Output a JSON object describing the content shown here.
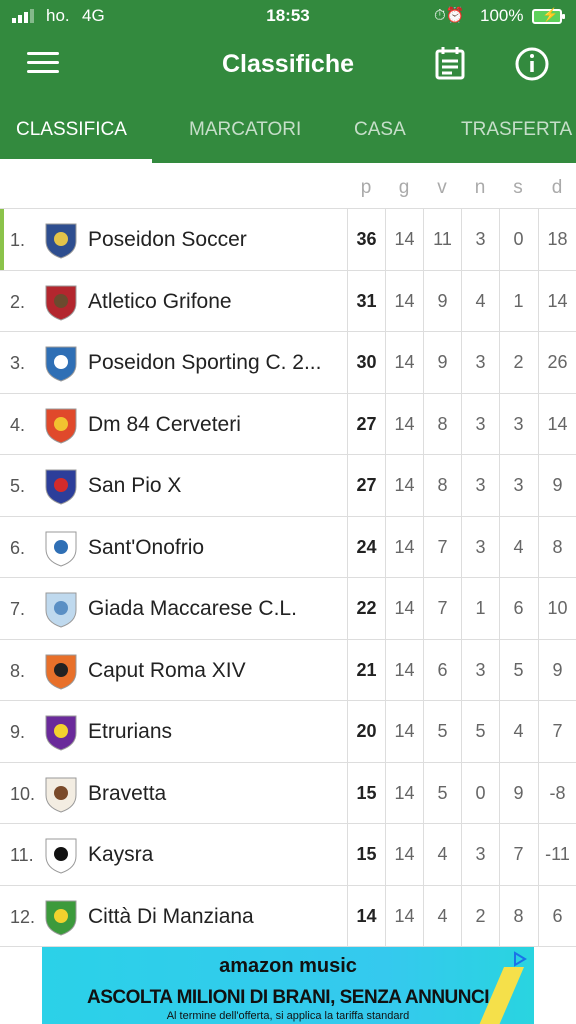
{
  "status": {
    "carrier": "ho.",
    "network": "4G",
    "time": "18:53",
    "battery": "100%"
  },
  "header": {
    "title": "Classifiche",
    "menu_icon": "hamburger-icon",
    "calendar_icon": "calendar-icon",
    "info_icon": "info-icon"
  },
  "tabs": [
    "CLASSIFICA",
    "MARCATORI",
    "CASA",
    "TRASFERTA"
  ],
  "columns": [
    "p",
    "g",
    "v",
    "n",
    "s",
    "d"
  ],
  "rows": [
    {
      "pos": "1.",
      "name": "Poseidon Soccer",
      "p": "36",
      "g": "14",
      "v": "11",
      "n": "3",
      "s": "0",
      "d": "18",
      "logo_color": "#2E4E8F",
      "logo_accent": "#E3C34A"
    },
    {
      "pos": "2.",
      "name": "Atletico Grifone",
      "p": "31",
      "g": "14",
      "v": "9",
      "n": "4",
      "s": "1",
      "d": "14",
      "logo_color": "#B3262E",
      "logo_accent": "#6B4A2E"
    },
    {
      "pos": "3.",
      "name": "Poseidon Sporting C. 2...",
      "p": "30",
      "g": "14",
      "v": "9",
      "n": "3",
      "s": "2",
      "d": "26",
      "logo_color": "#2F6FB5",
      "logo_accent": "#FFFFFF"
    },
    {
      "pos": "4.",
      "name": "Dm 84 Cerveteri",
      "p": "27",
      "g": "14",
      "v": "8",
      "n": "3",
      "s": "3",
      "d": "14",
      "logo_color": "#E0492B",
      "logo_accent": "#F2C230"
    },
    {
      "pos": "5.",
      "name": "San Pio X",
      "p": "27",
      "g": "14",
      "v": "8",
      "n": "3",
      "s": "3",
      "d": "9",
      "logo_color": "#2C3E9A",
      "logo_accent": "#D22B2B"
    },
    {
      "pos": "6.",
      "name": "Sant'Onofrio",
      "p": "24",
      "g": "14",
      "v": "7",
      "n": "3",
      "s": "4",
      "d": "8",
      "logo_color": "#FFFFFF",
      "logo_accent": "#2F6FB5"
    },
    {
      "pos": "7.",
      "name": "Giada Maccarese C.L.",
      "p": "22",
      "g": "14",
      "v": "7",
      "n": "1",
      "s": "6",
      "d": "10",
      "logo_color": "#BFD9EE",
      "logo_accent": "#5A8FC4"
    },
    {
      "pos": "8.",
      "name": "Caput Roma XIV",
      "p": "21",
      "g": "14",
      "v": "6",
      "n": "3",
      "s": "5",
      "d": "9",
      "logo_color": "#E8702A",
      "logo_accent": "#222222"
    },
    {
      "pos": "9.",
      "name": "Etrurians",
      "p": "20",
      "g": "14",
      "v": "5",
      "n": "5",
      "s": "4",
      "d": "7",
      "logo_color": "#6A2A9A",
      "logo_accent": "#F2D22E"
    },
    {
      "pos": "10.",
      "name": "Bravetta",
      "p": "15",
      "g": "14",
      "v": "5",
      "n": "0",
      "s": "9",
      "d": "-8",
      "logo_color": "#F3EDE2",
      "logo_accent": "#7A4A2A"
    },
    {
      "pos": "11.",
      "name": "Kaysra",
      "p": "15",
      "g": "14",
      "v": "4",
      "n": "3",
      "s": "7",
      "d": "-11",
      "logo_color": "#FFFFFF",
      "logo_accent": "#111111"
    },
    {
      "pos": "12.",
      "name": "Città Di Manziana",
      "p": "14",
      "g": "14",
      "v": "4",
      "n": "2",
      "s": "8",
      "d": "6",
      "logo_color": "#3C9A3C",
      "logo_accent": "#F2D22E"
    }
  ],
  "ad": {
    "brand": "amazon music",
    "headline": "ASCOLTA MILIONI DI BRANI, SENZA ANNUNCI",
    "footnote": "Al termine dell'offerta, si applica la tariffa standard"
  }
}
